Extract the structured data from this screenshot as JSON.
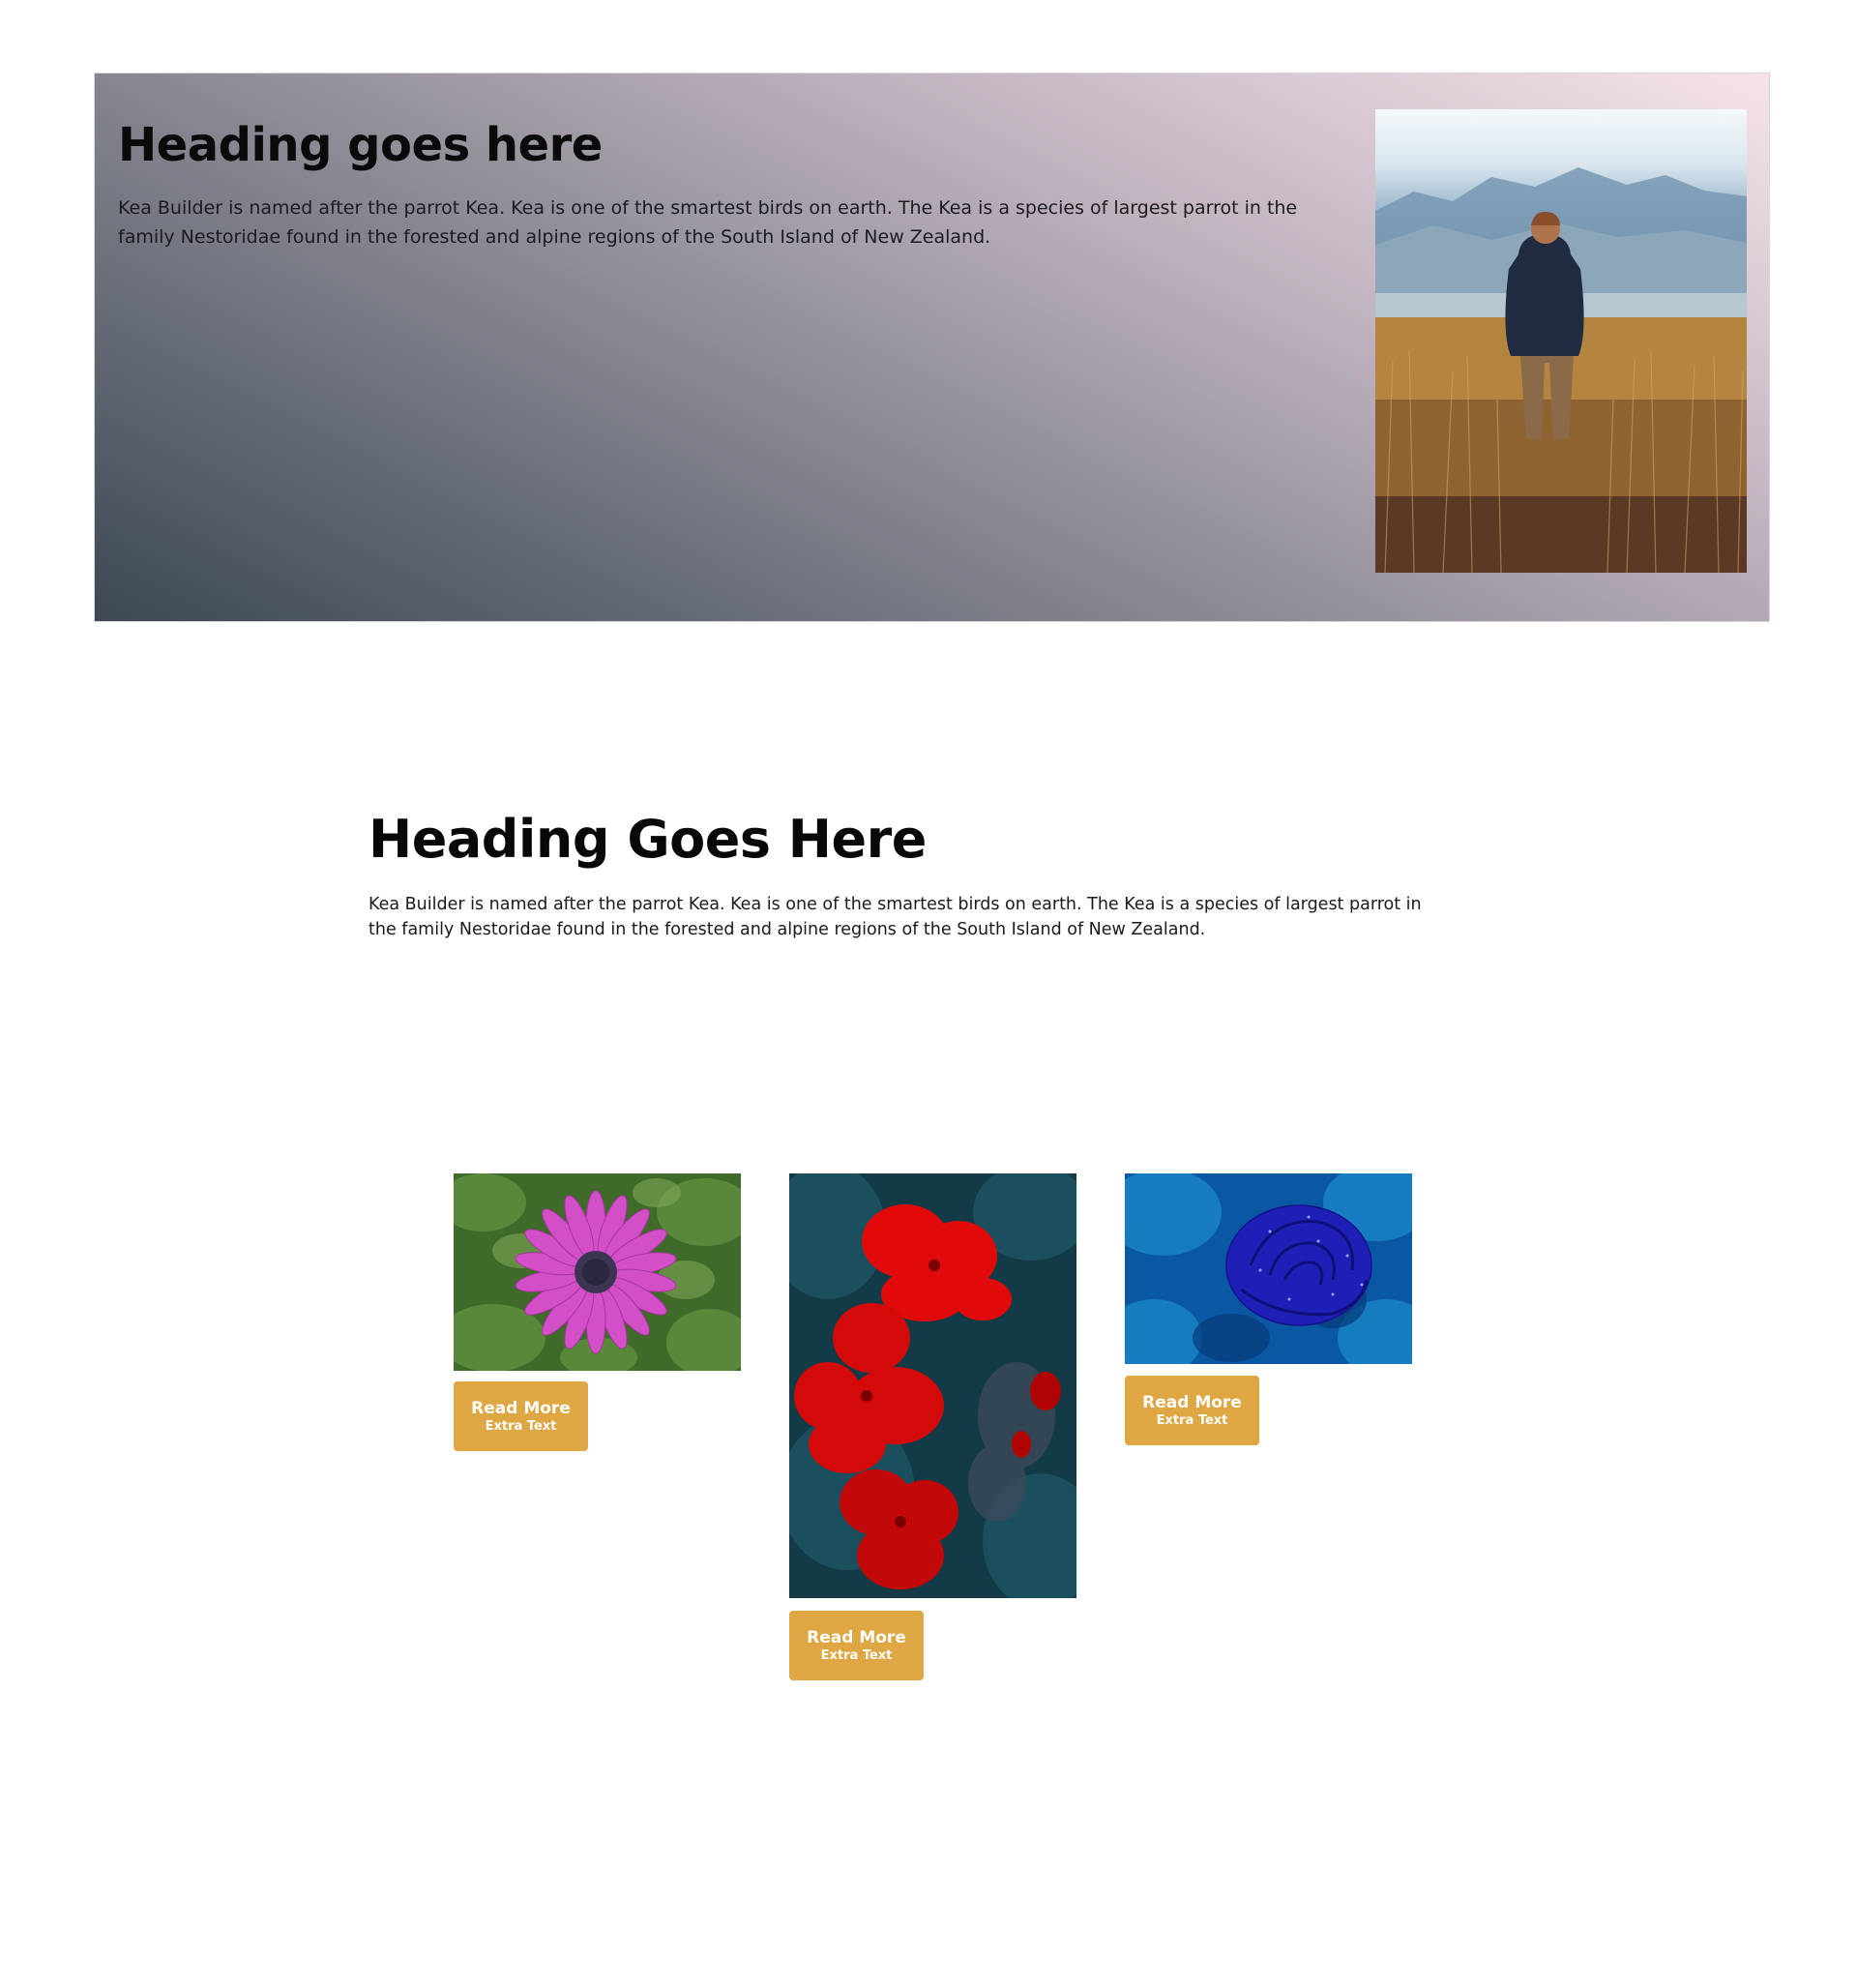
{
  "hero": {
    "heading": "Heading goes here",
    "text": "Kea Builder is named after the parrot Kea. Kea is one of the smartest birds on earth. The Kea is a species of largest parrot in the family Nestoridae found in the forested and alpine regions of the South Island of New Zealand.",
    "image": "man-in-field-photo",
    "gradient_colors": [
      "#3c4853",
      "#98949e",
      "#f6e3ea"
    ]
  },
  "section": {
    "heading": "Heading Goes Here",
    "text": "Kea Builder is named after the parrot Kea. Kea is one of the smartest birds on earth. The Kea is a species of largest parrot in the family Nestoridae found in the forested and alpine regions of the South Island of New Zealand."
  },
  "cards": [
    {
      "image": "pink-daisy-photo",
      "button_label": "Read More",
      "button_sub": "Extra Text"
    },
    {
      "image": "red-geranium-photo",
      "button_label": "Read More",
      "button_sub": "Extra Text"
    },
    {
      "image": "blue-rose-photo",
      "button_label": "Read More",
      "button_sub": "Extra Text"
    }
  ],
  "colors": {
    "button": "#dfa644",
    "button_text": "#ffffff",
    "text": "#111111"
  }
}
